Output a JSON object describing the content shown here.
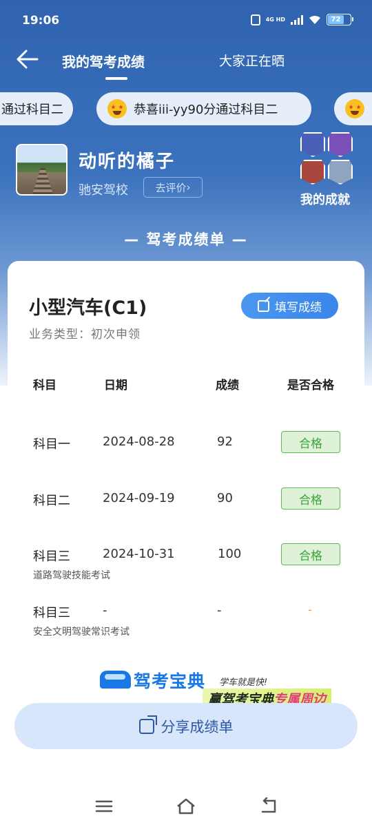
{
  "status_bar": {
    "time": "19:06",
    "network": "4G HD",
    "battery": "72"
  },
  "nav": {
    "tab_active": "我的驾考成绩",
    "tab_other": "大家正在晒"
  },
  "ticker": {
    "items": [
      "通过科目二",
      "恭喜iii-yy90分通过科目二",
      ""
    ]
  },
  "profile": {
    "name": "动听的橘子",
    "school": "驰安驾校",
    "rate_label": "去评价",
    "achievement_label": "我的成就"
  },
  "section_title": "— 驾考成绩单 —",
  "card": {
    "car_type": "小型汽车(C1)",
    "business_type": "业务类型：初次申领",
    "fill_button": "填写成绩",
    "headers": [
      "科目",
      "日期",
      "成绩",
      "是否合格"
    ],
    "rows": [
      {
        "subject": "科目一",
        "note": "",
        "date": "2024-08-28",
        "score": "92",
        "result": "合格"
      },
      {
        "subject": "科目二",
        "note": "",
        "date": "2024-09-19",
        "score": "90",
        "result": "合格"
      },
      {
        "subject": "科目三",
        "note": "道路驾驶技能考试",
        "date": "2024-10-31",
        "score": "100",
        "result": "合格"
      },
      {
        "subject": "科目三",
        "note": "安全文明驾驶常识考试",
        "date": "-",
        "score": "-",
        "result": "-"
      }
    ]
  },
  "brand": {
    "name": "驾考宝典",
    "slogan": "学车就是快!",
    "promo_prefix": "赢驾考宝典",
    "promo_highlight": "专属周边"
  },
  "share_button": "分享成绩单",
  "colors": {
    "primary_blue": "#3a85ea",
    "pass_green": "#3aa43a",
    "dash_orange": "#ff8a3c"
  }
}
